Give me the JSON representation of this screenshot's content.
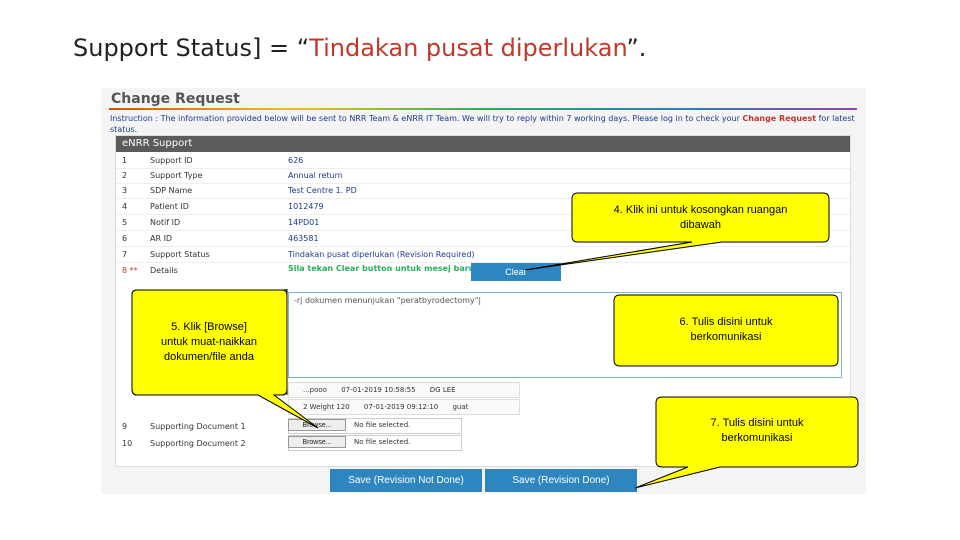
{
  "slide": {
    "title_prefix": "Support Status] = “",
    "title_highlight": "Tindakan pusat diperlukan",
    "title_suffix": "”."
  },
  "form": {
    "heading": "Change Request",
    "instruction_a": "Instruction : The information provided below will be sent to NRR Team & eNRR IT Team. We will try to reply within 7 working days. Please log in to check",
    "instruction_b": "your",
    "instruction_link": "Change Request",
    "instruction_c": "for latest status.",
    "panel_title": "eNRR Support",
    "rows": [
      {
        "n": "1",
        "label": "Support ID",
        "value": "626"
      },
      {
        "n": "2",
        "label": "Support Type",
        "value": "Annual return"
      },
      {
        "n": "3",
        "label": "SDP Name",
        "value": "Test Centre 1. PD"
      },
      {
        "n": "4",
        "label": "Patient ID",
        "value": "1012479"
      },
      {
        "n": "5",
        "label": "Notif ID",
        "value": "14PD01"
      },
      {
        "n": "6",
        "label": "AR ID",
        "value": "463581"
      },
      {
        "n": "7",
        "label": "Support Status",
        "value": "Tindakan pusat diperlukan  (Revision Required)"
      }
    ],
    "details_num": "8 **",
    "details_label": "Details",
    "clear_hint": "Sila tekan Clear button untuk mesej baru.",
    "clear_button": "Clear",
    "message_text": "-rj dokumen menunjukan \"peratbyrodectomy\"|",
    "history": [
      {
        "col1": "...pooo",
        "col2": "07-01-2019 10:58:55",
        "col3": "DG LEE"
      },
      {
        "col1": "2 Weight 120",
        "col2": "07-01-2019 09:12:10",
        "col3": "guat"
      }
    ],
    "doc1_num": "9",
    "doc1_label": "Supporting Document 1",
    "doc2_num": "10",
    "doc2_label": "Supporting Document 2",
    "browse_label": "Browse...",
    "no_file": "No file selected.",
    "save_not_done": "Save (Revision Not Done)",
    "save_done": "Save (Revision Done)"
  },
  "callouts": {
    "c4": [
      "4. Klik ini untuk kosongkan ruangan",
      "dibawah"
    ],
    "c5": [
      "5. Klik [Browse]",
      "untuk muat-naikkan",
      "dokumen/file anda"
    ],
    "c6": [
      "6. Tulis disini untuk",
      "berkomunikasi"
    ],
    "c7": [
      "7. Tulis disini untuk",
      "berkomunikasi"
    ]
  },
  "colors": {
    "callout_fill": "#ffff00",
    "accent": "#2e86c1",
    "highlight": "#c0392b"
  }
}
